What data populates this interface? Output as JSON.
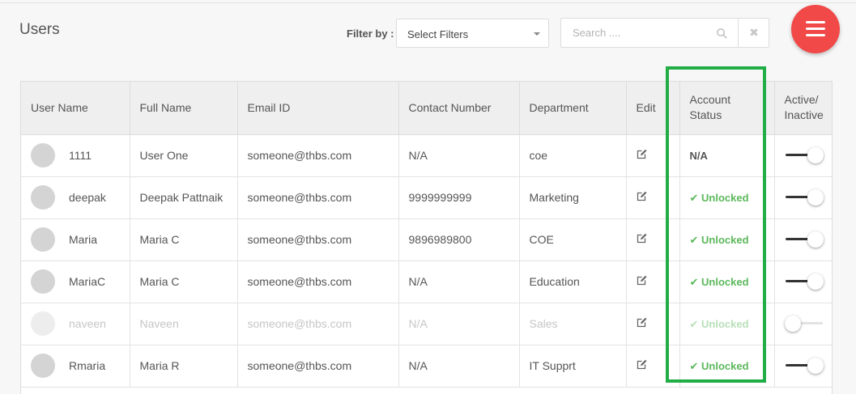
{
  "page": {
    "title": "Users"
  },
  "toolbar": {
    "filter_label": "Filter by :",
    "filter_value": "Select Filters",
    "search_placeholder": "Search ....",
    "clear_symbol": "✖"
  },
  "table": {
    "headers": {
      "user_name": "User Name",
      "full_name": "Full Name",
      "email": "Email ID",
      "contact": "Contact Number",
      "department": "Department",
      "edit": "Edit",
      "account_status_1": "Account",
      "account_status_2": "Status",
      "active_1": "Active/",
      "active_2": "Inactive"
    },
    "rows": [
      {
        "user_name": "1111",
        "full_name": "User One",
        "email": "someone@thbs.com",
        "contact": "N/A",
        "department": "coe",
        "status": "N/A",
        "active": true
      },
      {
        "user_name": "deepak",
        "full_name": "Deepak Pattnaik",
        "email": "someone@thbs.com",
        "contact": "9999999999",
        "department": "Marketing",
        "status": "✔ Unlocked",
        "active": true
      },
      {
        "user_name": "Maria",
        "full_name": "Maria C",
        "email": "someone@thbs.com",
        "contact": "9896989800",
        "department": "COE",
        "status": "✔ Unlocked",
        "active": true
      },
      {
        "user_name": "MariaC",
        "full_name": "Maria C",
        "email": "someone@thbs.com",
        "contact": "N/A",
        "department": "Education",
        "status": "✔ Unlocked",
        "active": true
      },
      {
        "user_name": "naveen",
        "full_name": "Naveen",
        "email": "someone@thbs.com",
        "contact": "N/A",
        "department": "Sales",
        "status": "✔ Unlocked",
        "active": false
      },
      {
        "user_name": "Rmaria",
        "full_name": "Maria R",
        "email": "someone@thbs.com",
        "contact": "N/A",
        "department": "IT Supprt",
        "status": "✔ Unlocked",
        "active": true
      }
    ]
  },
  "icons": {
    "search": "search-icon",
    "clear": "close-icon",
    "menu": "hamburger-menu-icon",
    "avatar": "user-avatar-icon",
    "edit": "edit-icon",
    "check": "check-icon"
  },
  "colors": {
    "menu_button": "#f14848",
    "unlocked_green": "#5cb85c",
    "highlight_green": "#22ae46"
  }
}
